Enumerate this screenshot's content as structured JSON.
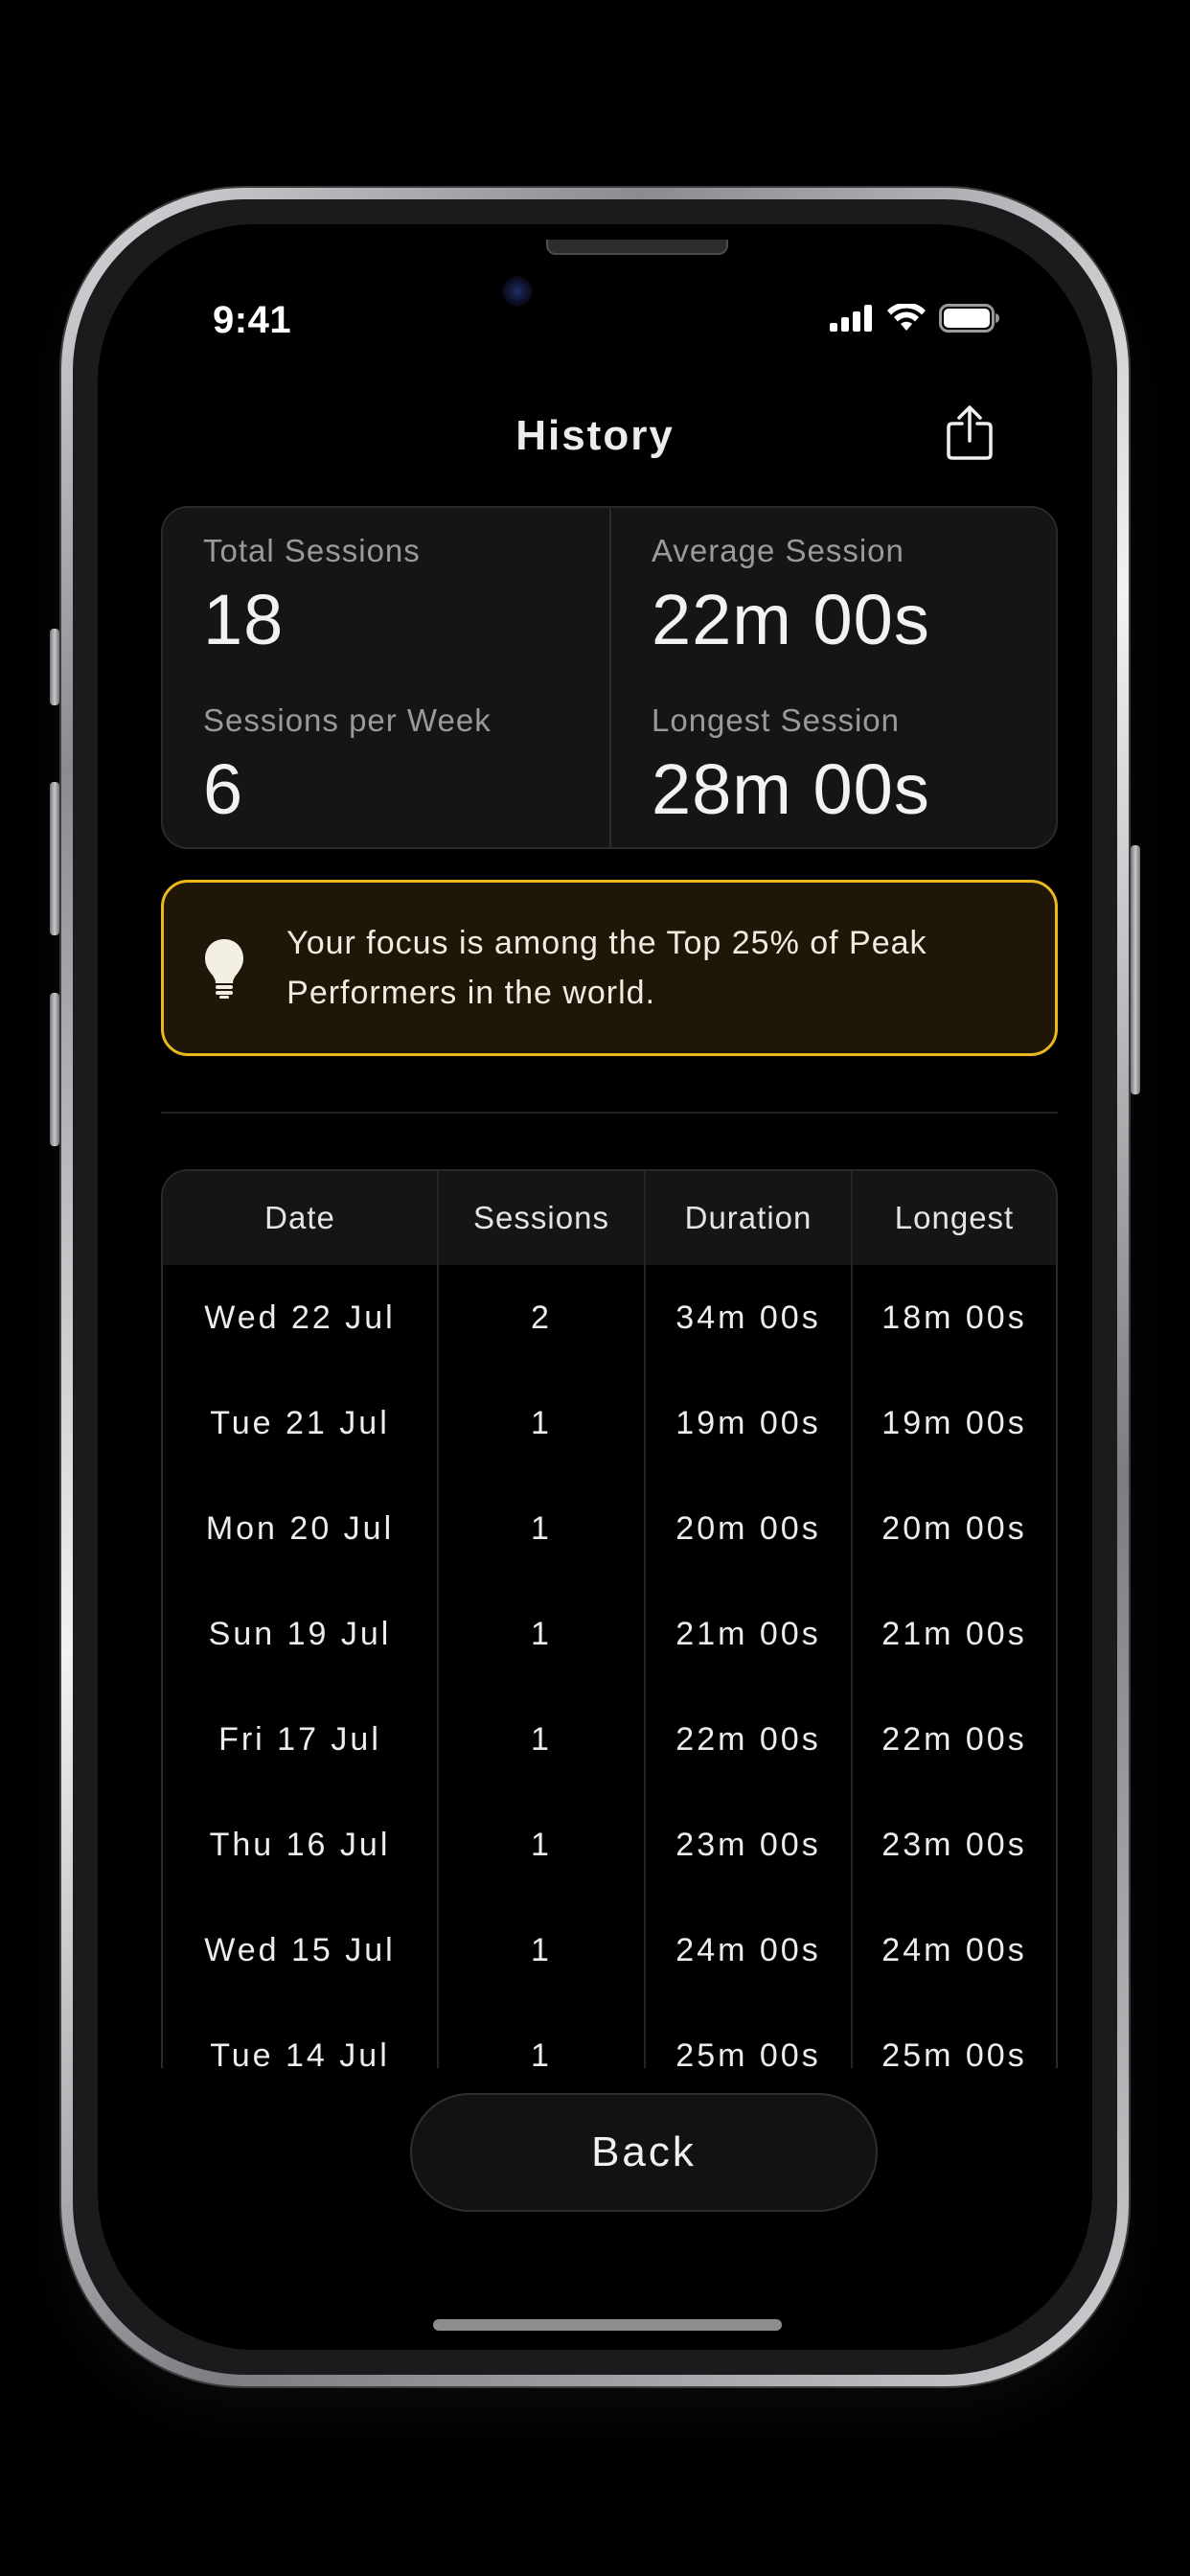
{
  "status_bar": {
    "time": "9:41",
    "icons": [
      "cellular-signal-icon",
      "wifi-icon",
      "battery-icon"
    ]
  },
  "header": {
    "title": "History",
    "share_icon": "share-icon"
  },
  "stats": {
    "total_sessions_label": "Total Sessions",
    "total_sessions_value": "18",
    "average_session_label": "Average Session",
    "average_session_value": "22m 00s",
    "sessions_per_week_label": "Sessions per Week",
    "sessions_per_week_value": "6",
    "longest_session_label": "Longest Session",
    "longest_session_value": "28m 00s"
  },
  "insight": {
    "icon": "lightbulb-icon",
    "text": "Your focus is among the Top 25% of Peak Performers in the world.",
    "accent_color": "#e9b91c"
  },
  "table": {
    "headers": [
      "Date",
      "Sessions",
      "Duration",
      "Longest"
    ],
    "rows": [
      [
        "Wed 22 Jul",
        "2",
        "34m 00s",
        "18m 00s"
      ],
      [
        "Tue 21 Jul",
        "1",
        "19m 00s",
        "19m 00s"
      ],
      [
        "Mon 20 Jul",
        "1",
        "20m 00s",
        "20m 00s"
      ],
      [
        "Sun 19 Jul",
        "1",
        "21m 00s",
        "21m 00s"
      ],
      [
        "Fri 17 Jul",
        "1",
        "22m 00s",
        "22m 00s"
      ],
      [
        "Thu 16 Jul",
        "1",
        "23m 00s",
        "23m 00s"
      ],
      [
        "Wed 15 Jul",
        "1",
        "24m 00s",
        "24m 00s"
      ],
      [
        "Tue 14 Jul",
        "1",
        "25m 00s",
        "25m 00s"
      ]
    ]
  },
  "back_button": {
    "label": "Back"
  }
}
